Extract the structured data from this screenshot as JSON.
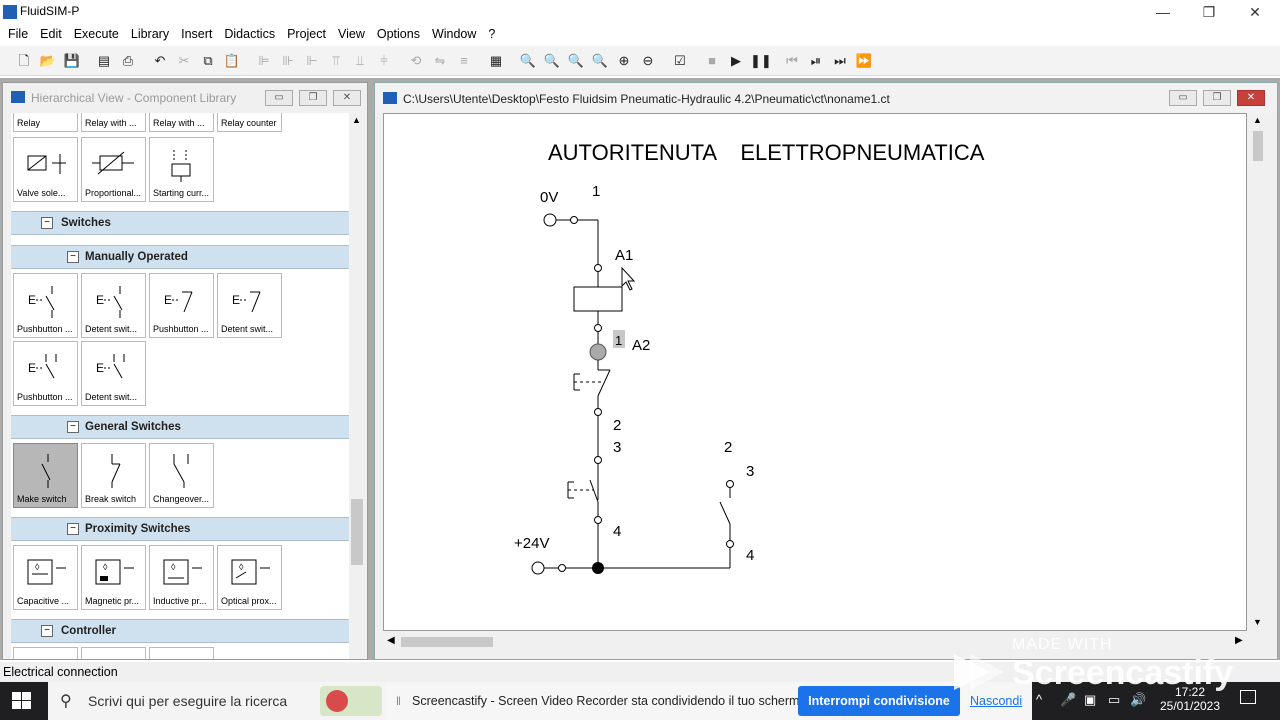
{
  "app": {
    "title": "FluidSIM-P",
    "window_controls": [
      "—",
      "❐",
      "✕"
    ]
  },
  "menu": [
    "File",
    "Edit",
    "Execute",
    "Library",
    "Insert",
    "Didactics",
    "Project",
    "View",
    "Options",
    "Window",
    "?"
  ],
  "library": {
    "title": "Hierarchical View - Component Library",
    "top_row": [
      "Relay",
      "Relay with ...",
      "Relay with ...",
      "Relay counter"
    ],
    "relay_row": [
      "Valve sole...",
      "Proportional...",
      "Starting curr..."
    ],
    "categories": {
      "switches": "Switches",
      "manually": "Manually Operated",
      "general": "General Switches",
      "proximity": "Proximity Switches",
      "controller": "Controller"
    },
    "manual_row1": [
      "Pushbutton ...",
      "Detent swit...",
      "Pushbutton ...",
      "Detent swit..."
    ],
    "manual_row2": [
      "Pushbutton ...",
      "Detent swit..."
    ],
    "general_row": [
      "Make switch",
      "Break switch",
      "Changeover..."
    ],
    "proximity_row": [
      "Capacitive ...",
      "Magnetic pr...",
      "Inductive pr...",
      "Optical prox..."
    ]
  },
  "drawing": {
    "title": "C:\\Users\\Utente\\Desktop\\Festo Fluidsim Pneumatic-Hydraulic 4.2\\Pneumatic\\ct\\noname1.ct",
    "heading": "AUTORITENUTA    ELETTROPNEUMATICA",
    "labels": {
      "zero_v": "0V",
      "plus_24v": "+24V",
      "a1": "A1",
      "a2": "A2",
      "relay_tag": "1",
      "n1": "1",
      "n2": "2",
      "n3": "3",
      "n4": "4",
      "m2": "2",
      "m3": "3",
      "m4": "4"
    }
  },
  "status": {
    "text": "Electrical connection"
  },
  "taskbar": {
    "search_placeholder": "Scrivi qui per eseguire la ricerca",
    "notification": "Screencastify - Screen Video Recorder sta condividendo il tuo schermo.",
    "stop_button": "Interrompi condivisione",
    "hide_link": "Nascondi",
    "time": "17:22",
    "date": "25/01/2023"
  },
  "watermark": {
    "made_with": "MADE WITH",
    "brand": "Screencastify"
  }
}
